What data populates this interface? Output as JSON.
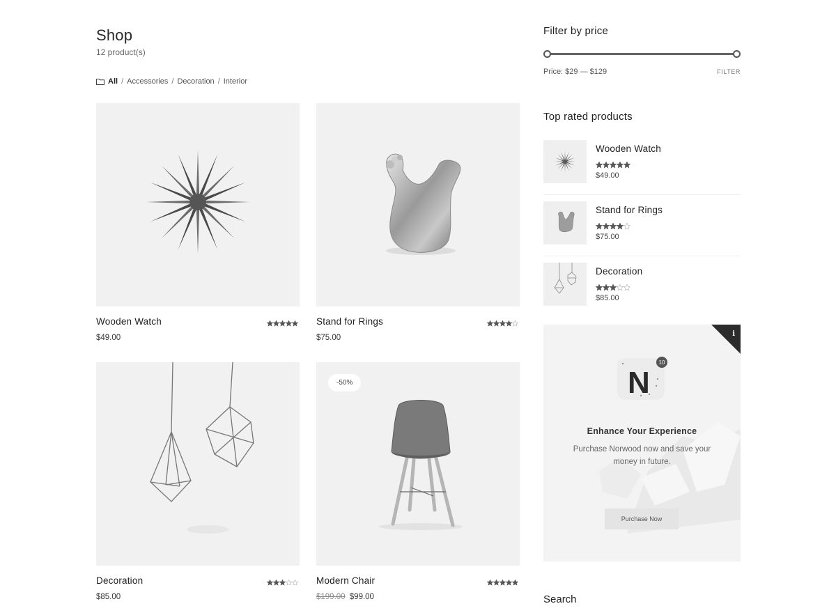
{
  "shop": {
    "title": "Shop",
    "product_count": "12 product(s)"
  },
  "breadcrumb": {
    "items": [
      "All",
      "Accessories",
      "Decoration",
      "Interior"
    ],
    "separator": "/"
  },
  "products": [
    {
      "name": "Wooden Watch",
      "price": "$49.00",
      "old_price": "",
      "rating": 5,
      "badge": ""
    },
    {
      "name": "Stand for Rings",
      "price": "$75.00",
      "old_price": "",
      "rating": 4,
      "badge": ""
    },
    {
      "name": "Decoration",
      "price": "$85.00",
      "old_price": "",
      "rating": 3,
      "badge": ""
    },
    {
      "name": "Modern Chair",
      "price": "$99.00",
      "old_price": "$199.00",
      "rating": 5,
      "badge": "-50%"
    }
  ],
  "filter": {
    "title": "Filter by price",
    "price_label": "Price: $29 — $129",
    "button": "FILTER",
    "min_fraction": 0,
    "max_fraction": 1
  },
  "top_rated": {
    "title": "Top rated products",
    "items": [
      {
        "name": "Wooden Watch",
        "price": "$49.00",
        "rating": 5
      },
      {
        "name": "Stand for Rings",
        "price": "$75.00",
        "rating": 4
      },
      {
        "name": "Decoration",
        "price": "$85.00",
        "rating": 3
      }
    ]
  },
  "promo": {
    "logo_letter": "N",
    "logo_badge": "10",
    "title": "Enhance Your  Experience",
    "text": "Purchase Norwood now and save your money in future.",
    "button": "Purchase Now",
    "info": "i"
  },
  "search": {
    "title": "Search"
  },
  "colors": {
    "star": "#555555",
    "star_empty": "#bbbbbb",
    "image_bg": "#f1f1f1"
  }
}
